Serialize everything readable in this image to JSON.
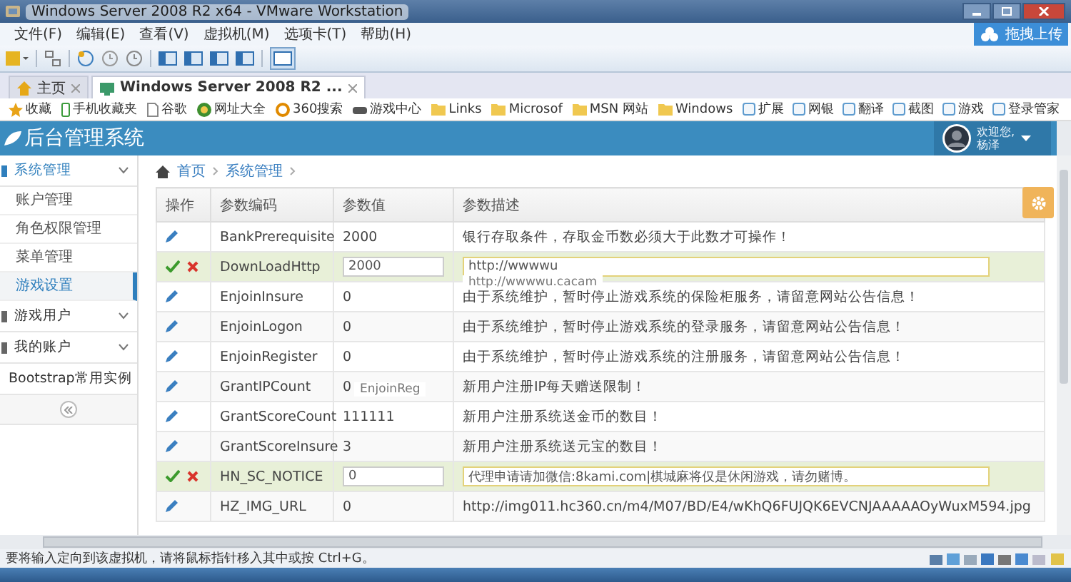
{
  "window": {
    "title": "Windows Server 2008 R2 x64 - VMware Workstation"
  },
  "upload_badge": {
    "label": "拖拽上传"
  },
  "menu": [
    "文件(F)",
    "编辑(E)",
    "查看(V)",
    "虚拟机(M)",
    "选项卡(T)",
    "帮助(H)"
  ],
  "vm_tabs": [
    {
      "label": "主页",
      "selected": false
    },
    {
      "label": "Windows Server 2008 R2 ...",
      "selected": true
    }
  ],
  "favorites": [
    {
      "label": "收藏",
      "kind": "star"
    },
    {
      "label": "手机收藏夹",
      "kind": "phone"
    },
    {
      "label": "谷歌",
      "kind": "page"
    },
    {
      "label": "网址大全",
      "kind": "globe"
    },
    {
      "label": "360搜索",
      "kind": "search"
    },
    {
      "label": "游戏中心",
      "kind": "game"
    },
    {
      "label": "Links",
      "kind": "folder"
    },
    {
      "label": "Microsof",
      "kind": "folder"
    },
    {
      "label": "MSN 网站",
      "kind": "folder"
    },
    {
      "label": "Windows",
      "kind": "folder"
    }
  ],
  "browser_tools": [
    "扩展",
    "网银",
    "翻译",
    "截图",
    "游戏",
    "登录管家"
  ],
  "app": {
    "title": "后台管理系统",
    "welcome": "欢迎您,",
    "user": "杨泽"
  },
  "sidebar": {
    "items": [
      {
        "label": "系统管理",
        "expanded": true,
        "children": [
          {
            "label": "账户管理",
            "selected": false
          },
          {
            "label": "角色权限管理",
            "selected": false
          },
          {
            "label": "菜单管理",
            "selected": false
          },
          {
            "label": "游戏设置",
            "selected": true
          }
        ]
      },
      {
        "label": "游戏用户",
        "expanded": false
      },
      {
        "label": "我的账户",
        "expanded": false
      },
      {
        "label": "Bootstrap常用实例",
        "expanded": false
      }
    ]
  },
  "breadcrumb": [
    "首页",
    "系统管理"
  ],
  "table": {
    "columns": [
      "操作",
      "参数编码",
      "参数值",
      "参数描述"
    ],
    "rows": [
      {
        "code": "BankPrerequisite",
        "value": "2000",
        "description": "银行存取条件，存取金币数必须大于此数才可操作！",
        "editing": false
      },
      {
        "code": "DownLoadHttp",
        "value": "2000",
        "description": "http://wwwwu",
        "editing": true,
        "suggestion": "http://wwwwu.cacam"
      },
      {
        "code": "EnjoinInsure",
        "value": "0",
        "description": "由于系统维护，暂时停止游戏系统的保险柜服务，请留意网站公告信息！",
        "editing": false
      },
      {
        "code": "EnjoinLogon",
        "value": "0",
        "description": "由于系统维护，暂时停止游戏系统的登录服务，请留意网站公告信息！",
        "editing": false
      },
      {
        "code": "EnjoinRegister",
        "value": "0",
        "description": "由于系统维护，暂时停止游戏系统的注册服务，请留意网站公告信息！",
        "editing": false
      },
      {
        "code": "GrantIPCount",
        "value": "0",
        "description": "新用户注册IP每天赠送限制！",
        "editing": false,
        "suggestion": "EnjoinReg"
      },
      {
        "code": "GrantScoreCount",
        "value": "111111",
        "description": "新用户注册系统送金币的数目！",
        "editing": false
      },
      {
        "code": "GrantScoreInsure",
        "value": "3",
        "description": "新用户注册系统送元宝的数目！",
        "editing": false
      },
      {
        "code": "HN_SC_NOTICE",
        "value": "0",
        "description": "代理申请请加微信:8kami.com|棋城麻将仅是休闲游戏，请勿赌博。",
        "editing": true
      },
      {
        "code": "HZ_IMG_URL",
        "value": "0",
        "description": "http://img011.hc360.cn/m4/M07/BD/E4/wKhQ6FUJQK6EVCNJAAAAAOyWuxM594.jpg",
        "editing": false
      }
    ]
  },
  "status_bar": "要将输入定向到该虚拟机，请将鼠标指针移入其中或按 Ctrl+G。"
}
